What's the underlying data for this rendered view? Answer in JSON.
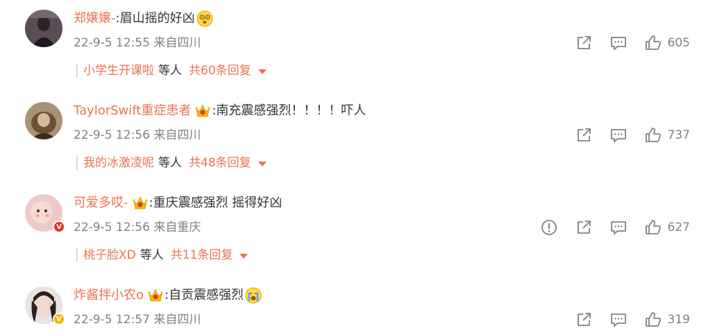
{
  "comments": [
    {
      "username": "郑嬢嬢-",
      "text": "眉山摇的好凶",
      "time": "22-9-5 12:55",
      "source": "来自四川",
      "likes": "605",
      "reply_user": "小学生开课啦",
      "reply_suffix": "等人",
      "reply_count": "共60条回复",
      "has_crown": false,
      "emoji": "dizzy-face-emoji"
    },
    {
      "username": "TaylorSwift重症患者",
      "text": "南充震感强烈！！！！吓人",
      "time": "22-9-5 12:56",
      "source": "来自四川",
      "likes": "737",
      "reply_user": "我的冰激凌呢",
      "reply_suffix": "等人",
      "reply_count": "共48条回复",
      "has_crown": true
    },
    {
      "username": "可爱多哎-",
      "text": "重庆震感强烈 摇得好凶",
      "time": "22-9-5 12:56",
      "source": "来自重庆",
      "likes": "627",
      "reply_user": "桃子脸XD",
      "reply_suffix": "等人",
      "reply_count": "共11条回复",
      "has_crown": true,
      "badge": "verified-red"
    },
    {
      "username": "炸酱拌小农o",
      "text": "自贡震感强烈",
      "time": "22-9-5 12:57",
      "source": "来自四川",
      "likes": "319",
      "has_crown": true,
      "badge": "verified-yellow",
      "emoji": "crying-face-emoji"
    }
  ],
  "colors": {
    "username": "#eb7350",
    "meta": "#808080",
    "text": "#333333",
    "badge_red": "#e2361f",
    "badge_yellow": "#f7b500"
  },
  "icons": {
    "share": "share-icon",
    "comment": "comment-icon",
    "like": "thumbs-up-icon",
    "report": "report-icon",
    "crown": "crown-icon"
  }
}
